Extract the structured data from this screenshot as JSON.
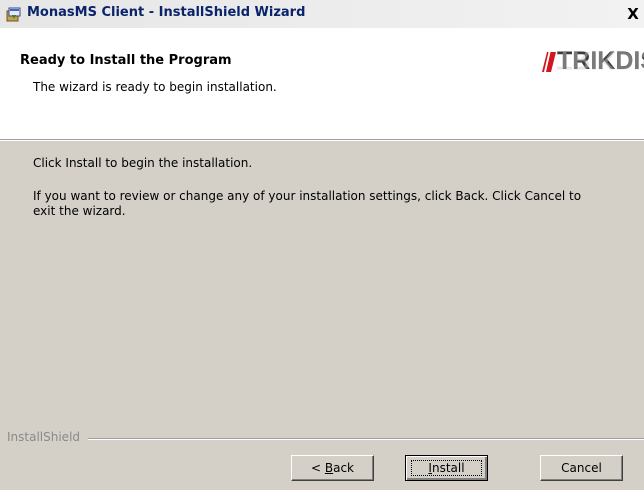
{
  "window": {
    "title": "MonasMS Client - InstallShield Wizard",
    "close_label": "X"
  },
  "header": {
    "title": "Ready to Install the Program",
    "subtitle": "The wizard is ready to begin installation.",
    "logo_text": "TRIKDIS"
  },
  "body": {
    "line1": "Click Install to begin the installation.",
    "line2a": "If you want to review or change any of your installation settings, click Back. Click Cancel to",
    "line2b": "exit the wizard."
  },
  "footer": {
    "branding": "InstallShield",
    "back_prefix": "< ",
    "back_accel": "B",
    "back_rest": "ack",
    "install_accel": "I",
    "install_rest": "nstall",
    "cancel_label": "Cancel"
  },
  "colors": {
    "face": "#d4d0c8",
    "title_text": "#0a246a",
    "logo_red": "#d4161c",
    "logo_text": "#3a3a3a"
  },
  "icons": [
    "installer-icon",
    "close-icon",
    "trikdis-logo"
  ]
}
